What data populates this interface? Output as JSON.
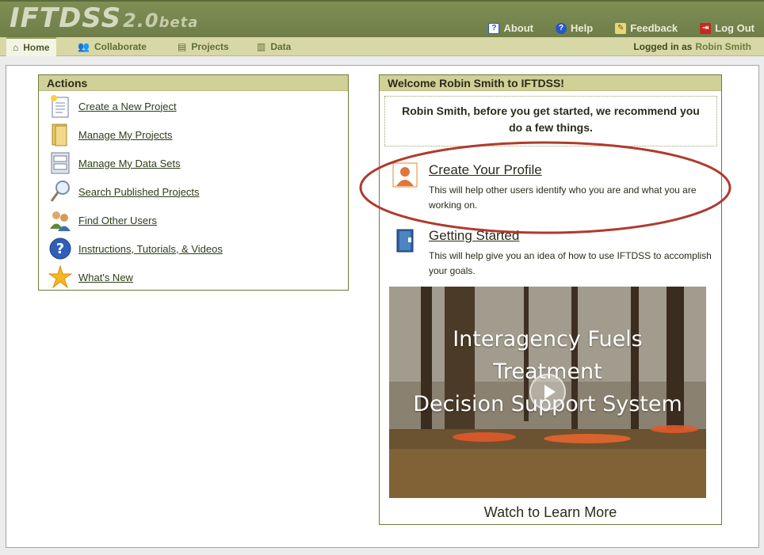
{
  "header": {
    "logo": "IFTDSS",
    "version": "2.0",
    "beta": "beta",
    "links": [
      {
        "label": "About",
        "icon": "about-icon"
      },
      {
        "label": "Help",
        "icon": "help-icon"
      },
      {
        "label": "Feedback",
        "icon": "feedback-icon"
      },
      {
        "label": "Log Out",
        "icon": "logout-icon"
      }
    ]
  },
  "tabs": [
    {
      "label": "Home",
      "icon": "home-icon",
      "active": true
    },
    {
      "label": "Collaborate",
      "icon": "users-icon"
    },
    {
      "label": "Projects",
      "icon": "projects-icon"
    },
    {
      "label": "Data",
      "icon": "data-icon"
    }
  ],
  "session": {
    "logged_in_as": "Logged in as",
    "user": "Robin Smith"
  },
  "actions": {
    "title": "Actions",
    "items": [
      {
        "label": "Create a New Project",
        "icon": "new-document-icon"
      },
      {
        "label": "Manage My Projects",
        "icon": "folder-icon"
      },
      {
        "label": "Manage My Data Sets",
        "icon": "file-cabinet-icon"
      },
      {
        "label": "Search Published Projects",
        "icon": "magnifier-icon"
      },
      {
        "label": "Find Other Users",
        "icon": "users-icon"
      },
      {
        "label": "Instructions, Tutorials, & Videos",
        "icon": "question-icon"
      },
      {
        "label": "What's New",
        "icon": "star-icon"
      }
    ]
  },
  "welcome": {
    "title": "Welcome Robin Smith to IFTDSS!",
    "tip_line1": "Robin Smith, before you get started, we recommend you",
    "tip_line2": "do a few things.",
    "items": [
      {
        "title": "Create Your Profile",
        "desc": "This will help other users identify who you are and what you are working on.",
        "icon": "profile-icon"
      },
      {
        "title": "Getting Started",
        "desc": "This will help give you an idea of how to use IFTDSS to accomplish your goals.",
        "icon": "book-icon"
      }
    ],
    "video": {
      "line1": "Interagency Fuels",
      "line2": "Treatment",
      "line3": "Decision Support System"
    },
    "watch": "Watch to Learn More"
  },
  "colors": {
    "header": "#7f8e55",
    "tabbar": "#d7d8a5",
    "panel_head": "#cfd197",
    "highlight": "#b03a2e"
  }
}
